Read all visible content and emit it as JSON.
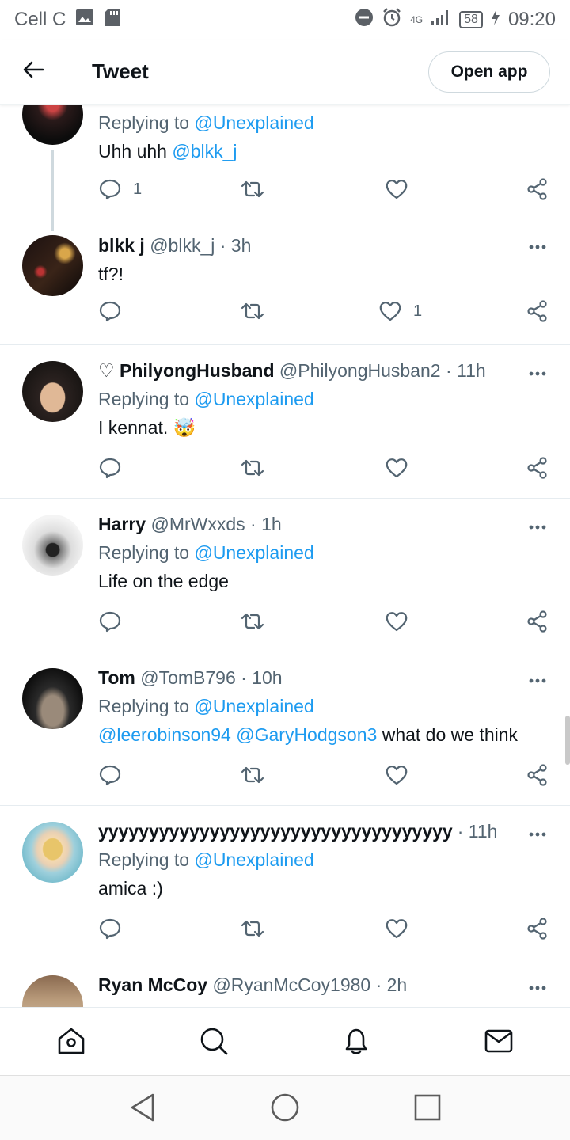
{
  "status_bar": {
    "carrier": "Cell C",
    "network": "4G",
    "battery": "58",
    "time": "09:20"
  },
  "header": {
    "title": "Tweet",
    "open_app_label": "Open app"
  },
  "tweets": [
    {
      "replying_prefix": "Replying to",
      "replying_handle": "@Unexplained",
      "text": "Uhh uhh",
      "mention": "@blkk_j",
      "reply_count": "1"
    },
    {
      "name": "blkk j",
      "meta": "@blkk_j · 3h",
      "text": "tf?!",
      "like_count": "1"
    },
    {
      "name": "♡ PhilyongHusband",
      "meta": "@PhilyongHusban2 · 11h",
      "replying_prefix": "Replying to",
      "replying_handle": "@Unexplained",
      "text": "I kennat. 🤯"
    },
    {
      "name": "Harry",
      "meta": "@MrWxxds · 1h",
      "replying_prefix": "Replying to",
      "replying_handle": "@Unexplained",
      "text": "Life on the edge"
    },
    {
      "name": "Tom",
      "meta": "@TomB796 · 10h",
      "replying_prefix": "Replying to",
      "replying_handle": "@Unexplained",
      "mention_1": "@leerobinson94",
      "mention_2": "@GaryHodgson3",
      "text": "what do we think"
    },
    {
      "name": "yyyyyyyyyyyyyyyyyyyyyyyyyyyyyyyyyyy",
      "meta": "· 11h",
      "replying_prefix": "Replying to",
      "replying_handle": "@Unexplained",
      "text": "amica :)"
    },
    {
      "name": "Ryan McCoy",
      "meta": "@RyanMcCoy1980 · 2h"
    }
  ],
  "icons": {
    "back": "arrow-left-icon",
    "reply": "speech-bubble-icon",
    "retweet": "retweet-icon",
    "like": "heart-icon",
    "share": "share-icon",
    "more": "more-dots-icon",
    "home": "home-icon",
    "search": "search-icon",
    "notifications": "bell-icon",
    "messages": "envelope-icon"
  },
  "colors": {
    "link": "#1d9bf0",
    "muted": "#536471"
  }
}
